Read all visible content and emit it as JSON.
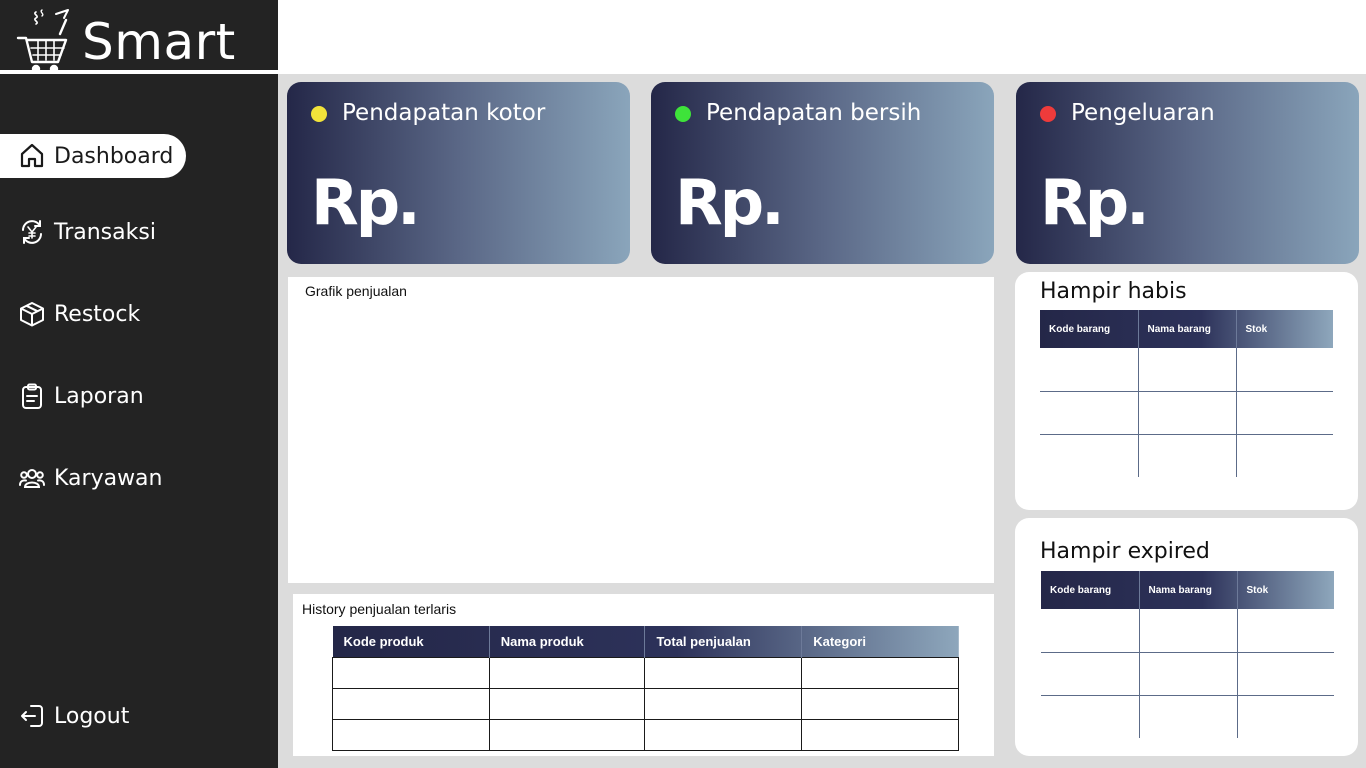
{
  "brand": {
    "name": "Smart",
    "logo": "shopping-cart-icon"
  },
  "sidebar": {
    "items": [
      {
        "label": "Dashboard",
        "icon": "home-icon",
        "active": true
      },
      {
        "label": "Transaksi",
        "icon": "currency-exchange-icon",
        "active": false
      },
      {
        "label": "Restock",
        "icon": "box-icon",
        "active": false
      },
      {
        "label": "Laporan",
        "icon": "clipboard-icon",
        "active": false
      },
      {
        "label": "Karyawan",
        "icon": "users-icon",
        "active": false
      }
    ],
    "logout": {
      "label": "Logout",
      "icon": "logout-icon"
    }
  },
  "cards": [
    {
      "title": "Pendapatan kotor",
      "value": "Rp.",
      "dot_color": "#f2e33a"
    },
    {
      "title": "Pendapatan bersih",
      "value": "Rp.",
      "dot_color": "#3ee33a"
    },
    {
      "title": "Pengeluaran",
      "value": "Rp.",
      "dot_color": "#ee3b3b"
    }
  ],
  "chart_panel": {
    "title": "Grafik penjualan"
  },
  "history": {
    "title": "History penjualan terlaris",
    "columns": [
      "Kode produk",
      "Nama produk",
      "Total penjualan",
      "Kategori"
    ],
    "rows": [
      [
        "",
        "",
        "",
        ""
      ],
      [
        "",
        "",
        "",
        ""
      ],
      [
        "",
        "",
        "",
        ""
      ]
    ]
  },
  "hampir_habis": {
    "title": "Hampir habis",
    "columns": [
      "Kode barang",
      "Nama barang",
      "Stok"
    ],
    "rows": [
      [
        "",
        "",
        ""
      ],
      [
        "",
        "",
        ""
      ],
      [
        "",
        "",
        ""
      ]
    ]
  },
  "hampir_expired": {
    "title": "Hampir expired",
    "columns": [
      "Kode barang",
      "Nama barang",
      "Stok"
    ],
    "rows": [
      [
        "",
        "",
        ""
      ],
      [
        "",
        "",
        ""
      ],
      [
        "",
        "",
        ""
      ]
    ]
  },
  "colors": {
    "sidebar_bg": "#232323",
    "card_gradient_start": "#242748",
    "card_gradient_end": "#8aa5bb"
  }
}
